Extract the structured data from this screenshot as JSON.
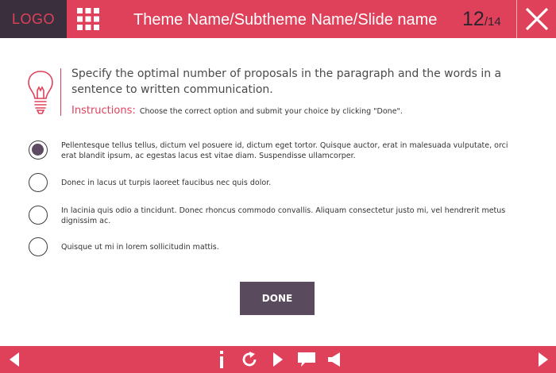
{
  "header": {
    "logo": "LOGO",
    "title": "Theme Name/Subtheme Name/Slide name",
    "current_slide": "12",
    "separator": "/",
    "total_slides": "14"
  },
  "question": {
    "text": "Specify the optimal number of proposals in the paragraph and the words in a sentence to written communication.",
    "instructions_label": "Instructions:",
    "instructions_text": "Choose the correct option and submit your choice by clicking \"Done\"."
  },
  "options": [
    {
      "text": "Pellentesque tellus tellus, dictum vel posuere id, dictum eget tortor. Quisque auctor, erat in malesuada vulputate, orci erat blandit ipsum, ac egestas lacus est vitae diam. Suspendisse ullamcorper.",
      "selected": true
    },
    {
      "text": "Donec in lacus ut turpis laoreet faucibus nec quis dolor.",
      "selected": false
    },
    {
      "text": "In lacinia quis odio a tincidunt. Donec rhoncus commodo convallis. Aliquam consectetur justo mi, vel hendrerit metus dignissim ac.",
      "selected": false
    },
    {
      "text": "Quisque ut mi in lorem sollicitudin mattis.",
      "selected": false
    }
  ],
  "done_label": "DONE",
  "colors": {
    "accent": "#e0415a",
    "dark": "#3a2f3d",
    "button": "#5a4a5d"
  },
  "footer_icons": [
    "prev-arrow-icon",
    "info-icon",
    "replay-icon",
    "play-icon",
    "comment-icon",
    "sound-icon",
    "next-arrow-icon"
  ]
}
